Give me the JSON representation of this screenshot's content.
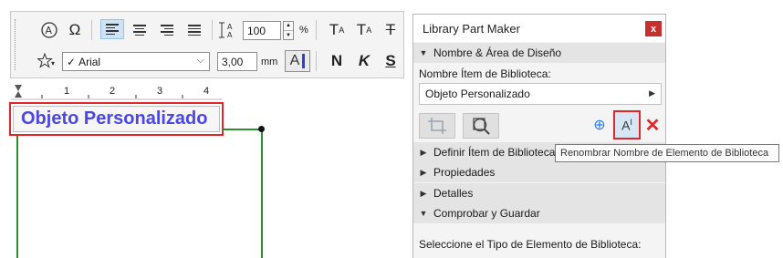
{
  "toolbar": {
    "font_size_value": "100",
    "font_size_unit": "%",
    "font_name": "Arial",
    "line_height_value": "3,00",
    "line_height_unit": "mm",
    "bold_label": "N",
    "italic_label": "K",
    "underline_label": "S",
    "char_A": "A"
  },
  "ruler": {
    "ticks": [
      "1",
      "2",
      "3",
      "4"
    ]
  },
  "canvas": {
    "object_label": "Objeto Personalizado"
  },
  "panel": {
    "title": "Library Part Maker",
    "close_glyph": "x",
    "section_name_design": "Nombre & Área de Diseño",
    "name_label": "Nombre Ítem de Biblioteca:",
    "name_value": "Objeto Personalizado",
    "section_define": "Definir Ítem de Biblioteca",
    "section_properties": "Propiedades",
    "section_details": "Detalles",
    "section_check_save": "Comprobar y Guardar",
    "select_type_label": "Seleccione el Tipo de Elemento de Biblioteca:"
  },
  "tooltip": {
    "text": "Renombrar Nombre de Elemento de Biblioteca"
  },
  "colors": {
    "accent_red": "#e0262a",
    "label_blue": "#4b47e0",
    "guide_green": "#2e8b2e",
    "add_blue": "#2b7de0"
  }
}
